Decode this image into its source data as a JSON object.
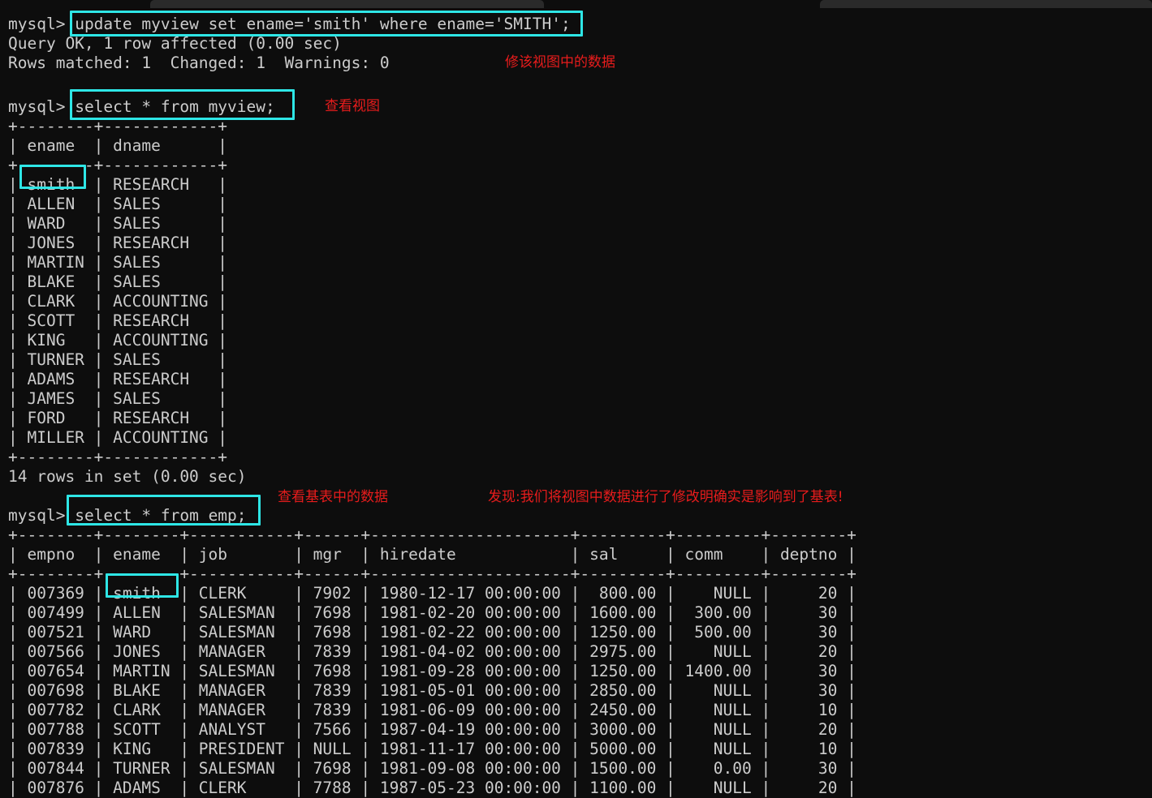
{
  "window": {
    "background_color": "#0d0d0d",
    "text_color": "#cccccc",
    "highlight_color": "#2ee6e6",
    "annotation_color": "#e81c1c",
    "tab_chip_color": "#2a2a2a"
  },
  "prompt": "mysql>",
  "session": {
    "command_1": "update myview set ename='smith' where ename='SMITH';",
    "result_1_line_1": "Query OK, 1 row affected (0.00 sec)",
    "result_1_line_2": "Rows matched: 1  Changed: 1  Warnings: 0",
    "command_2": "select * from myview;",
    "command_3": "select * from emp;",
    "row_count_myview": "14 rows in set (0.00 sec)"
  },
  "annotations": [
    {
      "name": "annotation-update-view",
      "text": "修该视图中的数据"
    },
    {
      "name": "annotation-view-select",
      "text": "查看视图"
    },
    {
      "name": "annotation-base-table",
      "text": "查看基表中的数据"
    },
    {
      "name": "annotation-conclusion",
      "text": "发现:我们将视图中数据进行了修改明确实是影响到了基表!"
    }
  ],
  "myview_table": {
    "border_top": "+--------+------------+",
    "header_row": "| ename  | dname      |",
    "border_mid": "+--------+------------+",
    "border_bottom": "+--------+------------+",
    "columns": [
      "ename",
      "dname"
    ],
    "rows": [
      [
        "smith",
        "RESEARCH"
      ],
      [
        "ALLEN",
        "SALES"
      ],
      [
        "WARD",
        "SALES"
      ],
      [
        "JONES",
        "RESEARCH"
      ],
      [
        "MARTIN",
        "SALES"
      ],
      [
        "BLAKE",
        "SALES"
      ],
      [
        "CLARK",
        "ACCOUNTING"
      ],
      [
        "SCOTT",
        "RESEARCH"
      ],
      [
        "KING",
        "ACCOUNTING"
      ],
      [
        "TURNER",
        "SALES"
      ],
      [
        "ADAMS",
        "RESEARCH"
      ],
      [
        "JAMES",
        "SALES"
      ],
      [
        "FORD",
        "RESEARCH"
      ],
      [
        "MILLER",
        "ACCOUNTING"
      ]
    ],
    "rendered_rows": [
      "| smith  | RESEARCH   |",
      "| ALLEN  | SALES      |",
      "| WARD   | SALES      |",
      "| JONES  | RESEARCH   |",
      "| MARTIN | SALES      |",
      "| BLAKE  | SALES      |",
      "| CLARK  | ACCOUNTING |",
      "| SCOTT  | RESEARCH   |",
      "| KING   | ACCOUNTING |",
      "| TURNER | SALES      |",
      "| ADAMS  | RESEARCH   |",
      "| JAMES  | SALES      |",
      "| FORD   | RESEARCH   |",
      "| MILLER | ACCOUNTING |"
    ]
  },
  "emp_table": {
    "border": "+--------+--------+-----------+------+---------------------+---------+---------+--------+",
    "header_row": "| empno  | ename  | job       | mgr  | hiredate            | sal     | comm    | deptno |",
    "columns": [
      "empno",
      "ename",
      "job",
      "mgr",
      "hiredate",
      "sal",
      "comm",
      "deptno"
    ],
    "rows": [
      [
        "007369",
        "smith",
        "CLERK",
        "7902",
        "1980-12-17 00:00:00",
        "800.00",
        "NULL",
        "20"
      ],
      [
        "007499",
        "ALLEN",
        "SALESMAN",
        "7698",
        "1981-02-20 00:00:00",
        "1600.00",
        "300.00",
        "30"
      ],
      [
        "007521",
        "WARD",
        "SALESMAN",
        "7698",
        "1981-02-22 00:00:00",
        "1250.00",
        "500.00",
        "30"
      ],
      [
        "007566",
        "JONES",
        "MANAGER",
        "7839",
        "1981-04-02 00:00:00",
        "2975.00",
        "NULL",
        "20"
      ],
      [
        "007654",
        "MARTIN",
        "SALESMAN",
        "7698",
        "1981-09-28 00:00:00",
        "1250.00",
        "1400.00",
        "30"
      ],
      [
        "007698",
        "BLAKE",
        "MANAGER",
        "7839",
        "1981-05-01 00:00:00",
        "2850.00",
        "NULL",
        "30"
      ],
      [
        "007782",
        "CLARK",
        "MANAGER",
        "7839",
        "1981-06-09 00:00:00",
        "2450.00",
        "NULL",
        "10"
      ],
      [
        "007788",
        "SCOTT",
        "ANALYST",
        "7566",
        "1987-04-19 00:00:00",
        "3000.00",
        "NULL",
        "20"
      ],
      [
        "007839",
        "KING",
        "PRESIDENT",
        "NULL",
        "1981-11-17 00:00:00",
        "5000.00",
        "NULL",
        "10"
      ],
      [
        "007844",
        "TURNER",
        "SALESMAN",
        "7698",
        "1981-09-08 00:00:00",
        "1500.00",
        "0.00",
        "30"
      ],
      [
        "007876",
        "ADAMS",
        "CLERK",
        "7788",
        "1987-05-23 00:00:00",
        "1100.00",
        "NULL",
        "20"
      ]
    ],
    "rendered_rows": [
      "| 007369 | smith  | CLERK     | 7902 | 1980-12-17 00:00:00 |  800.00 |    NULL |     20 |",
      "| 007499 | ALLEN  | SALESMAN  | 7698 | 1981-02-20 00:00:00 | 1600.00 |  300.00 |     30 |",
      "| 007521 | WARD   | SALESMAN  | 7698 | 1981-02-22 00:00:00 | 1250.00 |  500.00 |     30 |",
      "| 007566 | JONES  | MANAGER   | 7839 | 1981-04-02 00:00:00 | 2975.00 |    NULL |     20 |",
      "| 007654 | MARTIN | SALESMAN  | 7698 | 1981-09-28 00:00:00 | 1250.00 | 1400.00 |     30 |",
      "| 007698 | BLAKE  | MANAGER   | 7839 | 1981-05-01 00:00:00 | 2850.00 |    NULL |     30 |",
      "| 007782 | CLARK  | MANAGER   | 7839 | 1981-06-09 00:00:00 | 2450.00 |    NULL |     10 |",
      "| 007788 | SCOTT  | ANALYST   | 7566 | 1987-04-19 00:00:00 | 3000.00 |    NULL |     20 |",
      "| 007839 | KING   | PRESIDENT | NULL | 1981-11-17 00:00:00 | 5000.00 |    NULL |     10 |",
      "| 007844 | TURNER | SALESMAN  | 7698 | 1981-09-08 00:00:00 | 1500.00 |    0.00 |     30 |",
      "| 007876 | ADAMS  | CLERK     | 7788 | 1987-05-23 00:00:00 | 1100.00 |    NULL |     20 |"
    ]
  }
}
